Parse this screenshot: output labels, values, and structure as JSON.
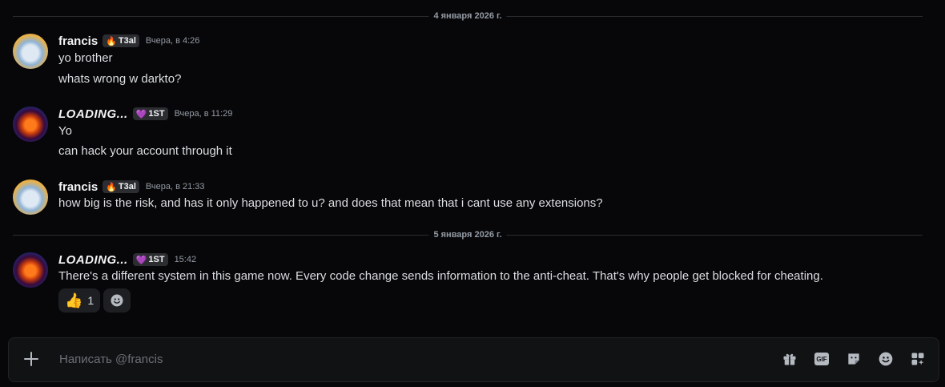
{
  "dividers": [
    "4 января 2026 г.",
    "5 января 2026 г."
  ],
  "messages": [
    {
      "author": "francis",
      "tag_icon": "flame-icon",
      "tag": "T3al",
      "time": "Вчера, в 4:26",
      "lines": [
        "yo brother",
        "whats wrong w darkto?"
      ]
    },
    {
      "author": "LOADING...",
      "tag_icon": "heart-icon",
      "tag": "1ST",
      "time": "Вчера, в 11:29",
      "lines": [
        "Yo",
        "can hack your account through it"
      ]
    },
    {
      "author": "francis",
      "tag_icon": "flame-icon",
      "tag": "T3al",
      "time": "Вчера, в 21:33",
      "lines": [
        "how big is the risk, and has it only happened to u? and does that mean that i cant use any extensions?"
      ]
    },
    {
      "author": "LOADING...",
      "tag_icon": "heart-icon",
      "tag": "1ST",
      "time": "15:42",
      "lines": [
        "There's a different system in this game now. Every code change sends information to the anti-cheat. That's why people get blocked for cheating."
      ],
      "reactions": [
        {
          "emoji": "thumbs-up-icon",
          "count": "1"
        }
      ]
    }
  ],
  "composer": {
    "placeholder": "Написать @francis",
    "tools": [
      "gift-icon",
      "gif-icon",
      "sticker-icon",
      "emoji-icon",
      "apps-icon"
    ],
    "gif_label": "GIF"
  },
  "colors": {
    "background": "#070709",
    "username": "#f2f3f5",
    "timestamp": "#949ba4",
    "text": "#dbdee1"
  }
}
